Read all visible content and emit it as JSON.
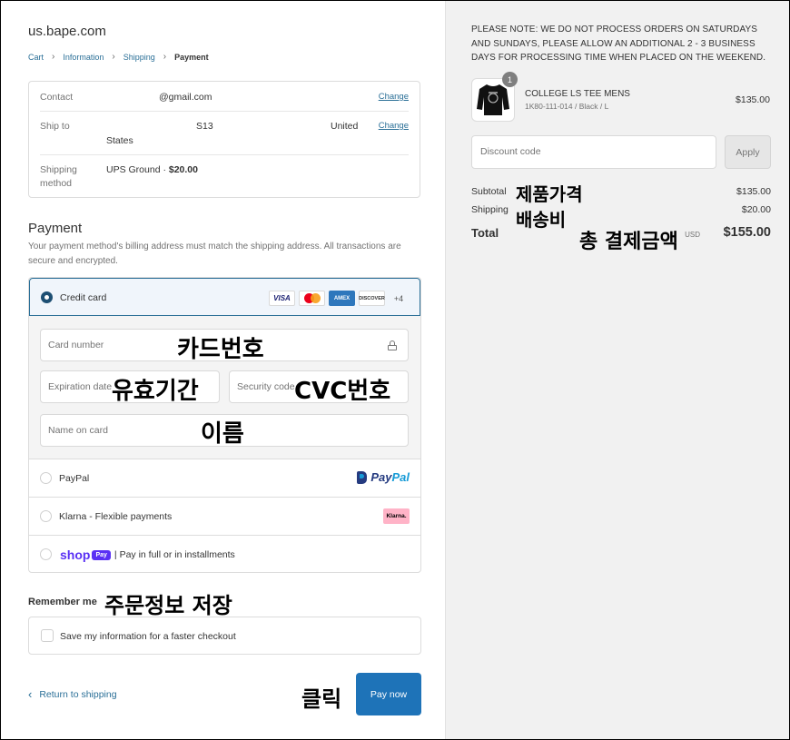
{
  "store": {
    "name": "us.bape.com"
  },
  "breadcrumb": {
    "cart": "Cart",
    "information": "Information",
    "shipping": "Shipping",
    "payment": "Payment"
  },
  "review": {
    "contact_label": "Contact",
    "contact_value": "@gmail.com",
    "ship_label": "Ship to",
    "ship_part1": "S13",
    "ship_part2": "United",
    "ship_part3": "States",
    "method_label_1": "Shipping",
    "method_label_2": "method",
    "method_value": "UPS Ground · ",
    "method_price": "$20.00",
    "change": "Change"
  },
  "payment": {
    "title": "Payment",
    "subtitle": "Your payment method's billing address must match the shipping address. All transactions are secure and encrypted.",
    "credit_card": "Credit card",
    "logos": {
      "visa": "VISA",
      "amex": "AMEX",
      "discover": "DISCOVER",
      "more": "+4"
    },
    "card_number": "Card number",
    "expiration": "Expiration date",
    "security": "Security code",
    "name_on_card": "Name on card",
    "paypal": "PayPal",
    "paypal_logo_1": "Pay",
    "paypal_logo_2": "Pal",
    "klarna": "Klarna - Flexible payments",
    "klarna_logo": "Klarna.",
    "shop_word": "shop",
    "shop_pay": "Pay",
    "shop_text": "| Pay in full or in installments"
  },
  "remember": {
    "title": "Remember me",
    "save": "Save my information for a faster checkout"
  },
  "footer": {
    "return": "Return to shipping",
    "pay_now": "Pay now"
  },
  "annotations": {
    "card_number": "카드번호",
    "expiration": "유효기간",
    "security": "CVC번호",
    "name": "이름",
    "remember": "주문정보  저장",
    "click": "클릭",
    "subtotal": "제품가격",
    "shipping": "배송비",
    "total": "총  결제금액"
  },
  "summary": {
    "notice": "PLEASE NOTE: WE DO NOT PROCESS ORDERS ON SATURDAYS AND SUNDAYS, PLEASE ALLOW AN ADDITIONAL 2 - 3 BUSINESS DAYS FOR PROCESSING TIME WHEN PLACED ON THE WEEKEND.",
    "product": {
      "quantity": "1",
      "name": "COLLEGE LS TEE MENS",
      "variant": "1K80-111-014 / Black / L",
      "price": "$135.00"
    },
    "discount_placeholder": "Discount code",
    "apply": "Apply",
    "subtotal_label": "Subtotal",
    "subtotal": "$135.00",
    "shipping_label": "Shipping",
    "shipping": "$20.00",
    "total_label": "Total",
    "currency": "USD",
    "total": "$155.00"
  },
  "colors": {
    "accent": "#2a6f97",
    "pay_button": "#1e73b8",
    "shop_purple": "#5a31f4",
    "klarna_pink": "#ffb3c7"
  }
}
